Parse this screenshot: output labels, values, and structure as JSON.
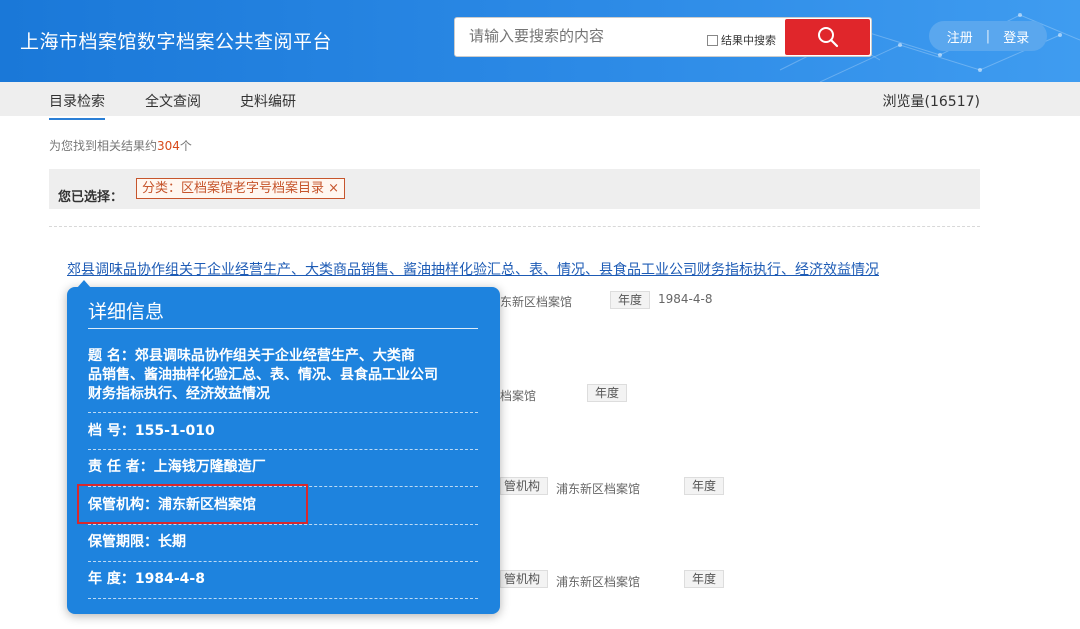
{
  "header": {
    "title": "上海市档案馆数字档案公共查阅平台",
    "search_placeholder": "请输入要搜索的内容",
    "in_result_label": "结果中搜索",
    "search_icon": "search-icon",
    "register_label": "注册",
    "separator": "|",
    "login_label": "登录"
  },
  "nav": {
    "tabs": [
      {
        "label": "目录检索",
        "active": true
      },
      {
        "label": "全文查阅",
        "active": false
      },
      {
        "label": "史料编研",
        "active": false
      }
    ],
    "views": "浏览量(16517)"
  },
  "results": {
    "count_prefix": "为您找到相关结果约",
    "count": "304",
    "count_suffix": "个",
    "selected_label": "您已选择：",
    "filter_tag": "分类：区档案馆老字号档案目录 ×"
  },
  "record": {
    "title": "郊县调味品协作组关于企业经营生产、大类商品销售、酱油抽样化验汇总、表、情况、县食品工业公司财务指标执行、经济效益情况"
  },
  "rows": [
    {
      "archive": "东新区档案馆",
      "year_label": "年度",
      "year": "1984-4-8"
    },
    {
      "archive": "档案馆",
      "year_label": "年度"
    },
    {
      "institution_label": "管机构",
      "archive": "浦东新区档案馆",
      "year_label": "年度"
    },
    {
      "institution_label": "管机构",
      "archive": "浦东新区档案馆",
      "year_label": "年度"
    }
  ],
  "popup": {
    "heading": "详细信息",
    "title_label": "题  名：",
    "title_value_l1": "郊县调味品协作组关于企业经营生产、大类商",
    "title_value_l2": "品销售、酱油抽样化验汇总、表、情况、县食品工业公司",
    "title_value_l3": "财务指标执行、经济效益情况",
    "doc_no_label": "档  号：",
    "doc_no": "155-1-010",
    "responsible_label": "责 任 者：",
    "responsible": "上海钱万隆酿造厂",
    "custodian_label": "保管机构：",
    "custodian": "浦东新区档案馆",
    "retention_label": "保管期限：",
    "retention": "长期",
    "year_label": "年  度：",
    "year": "1984-4-8"
  },
  "colors": {
    "header_blue": "#1a78d8",
    "popup_blue": "#1e83de",
    "search_red": "#e0262b",
    "link_blue": "#1d5bb5",
    "accent_orange": "#d84a1b"
  }
}
